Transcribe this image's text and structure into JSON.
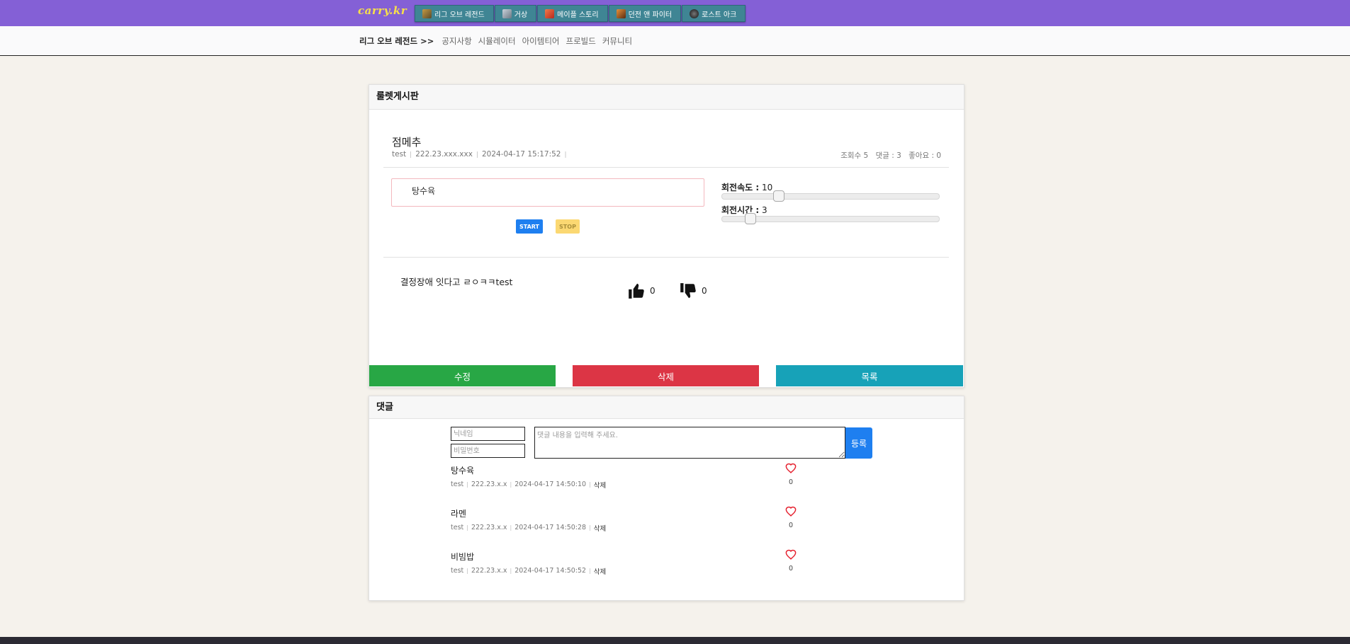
{
  "site": {
    "logo": "carry.kr"
  },
  "game_tabs": [
    {
      "label": "리그 오브 레전드",
      "icon": "lol-icon",
      "color": "#c59a43"
    },
    {
      "label": "거상",
      "icon": "gersang-icon",
      "color": "#9aa5b1"
    },
    {
      "label": "메이플 스토리",
      "icon": "maple-icon",
      "color": "#e0533c"
    },
    {
      "label": "던전 앤 파이터",
      "icon": "dnf-icon",
      "color": "#d06b2e"
    },
    {
      "label": "로스트 아크",
      "icon": "lostark-icon",
      "color": "#333333"
    }
  ],
  "subnav": {
    "title": "리그 오브 레전드 >>",
    "links": [
      "공지사항",
      "시뮬레이터",
      "아이템티어",
      "프로빌드",
      "커뮤니티"
    ]
  },
  "board": {
    "header": "룰렛게시판",
    "post": {
      "title": "점메추",
      "author": "test",
      "ip": "222.23.xxx.xxx",
      "date": "2024-04-17 15:17:52",
      "views": "조회수 5",
      "comments": "댓글 : 3",
      "likes": "좋아요 : 0",
      "content": "결정장애 잇다고 ㄹㅇㅋㅋtest"
    },
    "roulette": {
      "item": "탕수육",
      "start_label": "START",
      "stop_label": "STOP",
      "speed_label": "회전속도 :",
      "speed_value": "10",
      "speed_level": 0.26,
      "time_label": "회전시간 :",
      "time_value": "3",
      "time_level": 0.13
    },
    "votes": {
      "up": "0",
      "down": "0"
    },
    "actions": {
      "edit": "수정",
      "delete": "삭제",
      "list": "목록"
    }
  },
  "comments_section": {
    "header": "댓글",
    "nickname_placeholder": "닉네임",
    "password_placeholder": "비밀번호",
    "content_placeholder": "댓글 내용을 입력해 주세요.",
    "submit_label": "등록",
    "delete_label": "삭제",
    "items": [
      {
        "name": "탕수육",
        "author": "test",
        "ip": "222.23.x.x",
        "date": "2024-04-17 14:50:10",
        "likes": "0"
      },
      {
        "name": "라멘",
        "author": "test",
        "ip": "222.23.x.x",
        "date": "2024-04-17 14:50:28",
        "likes": "0"
      },
      {
        "name": "비빔밥",
        "author": "test",
        "ip": "222.23.x.x",
        "date": "2024-04-17 14:50:52",
        "likes": "0"
      }
    ]
  },
  "colors": {
    "header_bg": "#8460d6",
    "tab_bg": "#3f8594",
    "edit": "#28a745",
    "delete": "#dc3545",
    "list": "#17a2b8",
    "primary": "#1e7ff0",
    "heart": "#e5202e"
  }
}
